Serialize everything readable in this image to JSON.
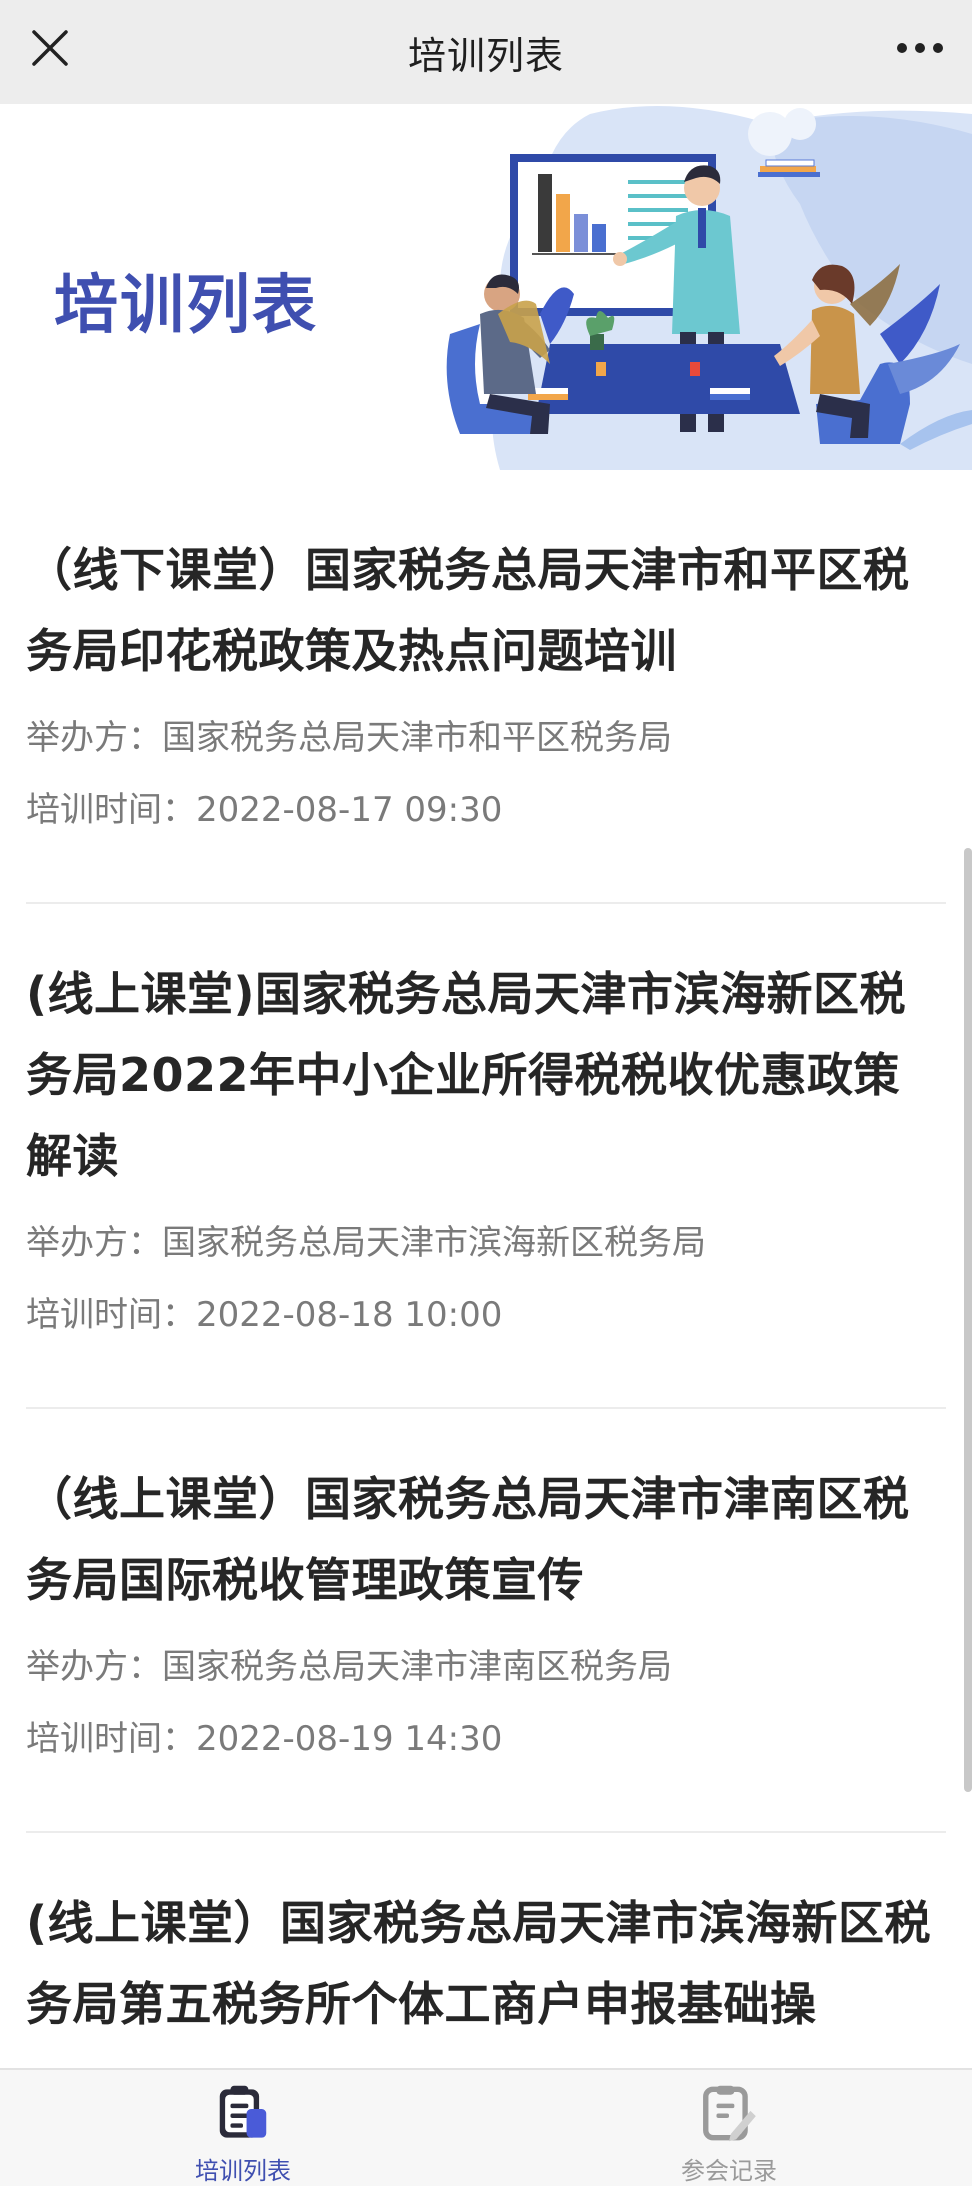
{
  "nav": {
    "title": "培训列表",
    "close_icon": "close-icon",
    "more_icon": "more-dots-icon"
  },
  "banner": {
    "title": "培训列表",
    "illustration": "training-meeting-illustration",
    "accent_color": "#3f4fb0"
  },
  "trainings": [
    {
      "title": "（线下课堂）国家税务总局天津市和平区税务局印花税政策及热点问题培训",
      "organizer_label": "举办方：",
      "organizer": "国家税务总局天津市和平区税务局",
      "time_label": "培训时间：",
      "time": "2022-08-17 09:30"
    },
    {
      "title": "(线上课堂)国家税务总局天津市滨海新区税务局2022年中小企业所得税税收优惠政策解读",
      "organizer_label": "举办方：",
      "organizer": "国家税务总局天津市滨海新区税务局",
      "time_label": "培训时间：",
      "time": "2022-08-18 10:00"
    },
    {
      "title": "（线上课堂）国家税务总局天津市津南区税务局国际税收管理政策宣传",
      "organizer_label": "举办方：",
      "organizer": "国家税务总局天津市津南区税务局",
      "time_label": "培训时间：",
      "time": "2022-08-19 14:30"
    },
    {
      "title": "(线上课堂）国家税务总局天津市滨海新区税务局第五税务所个体工商户申报基础操",
      "organizer_label": "",
      "organizer": "",
      "time_label": "",
      "time": ""
    }
  ],
  "tabbar": {
    "tabs": [
      {
        "label": "培训列表",
        "icon": "training-list-icon",
        "active": true
      },
      {
        "label": "参会记录",
        "icon": "attendance-record-icon",
        "active": false
      }
    ]
  }
}
